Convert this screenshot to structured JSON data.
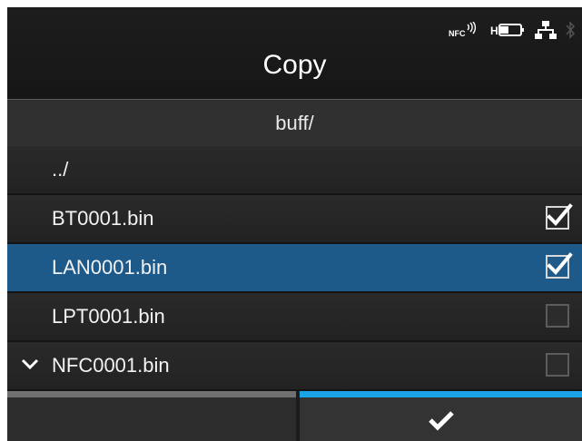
{
  "header": {
    "title": "Copy",
    "status_icons": [
      "nfc-icon",
      "battery-icon",
      "network-icon",
      "bluetooth-icon"
    ],
    "nfc_text": "NFC",
    "battery_text": "H"
  },
  "path": {
    "current_dir": "buff/"
  },
  "files": [
    {
      "name": "../",
      "checked": null,
      "selected": false,
      "chevron": false
    },
    {
      "name": "BT0001.bin",
      "checked": true,
      "selected": false,
      "chevron": false
    },
    {
      "name": "LAN0001.bin",
      "checked": true,
      "selected": true,
      "chevron": false
    },
    {
      "name": "LPT0001.bin",
      "checked": false,
      "selected": false,
      "chevron": false
    },
    {
      "name": "NFC0001.bin",
      "checked": false,
      "selected": false,
      "chevron": true
    }
  ],
  "footer": {
    "left_button_icon": "",
    "right_button_icon": "checkmark-icon"
  },
  "colors": {
    "selection": "#1d5a8a",
    "accent": "#1aa3e6"
  }
}
